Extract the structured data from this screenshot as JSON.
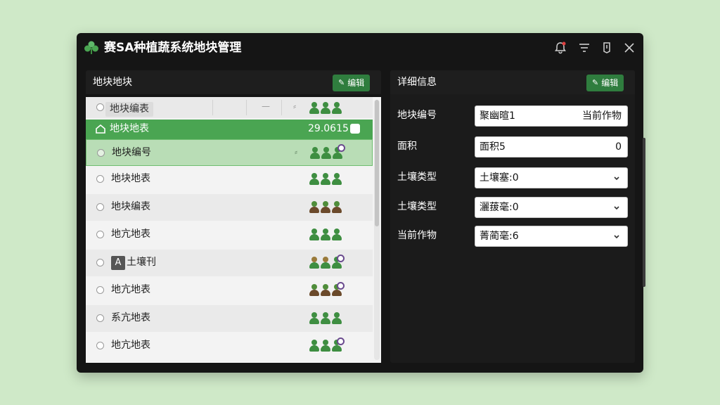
{
  "app": {
    "title": "赛SA种植蔬系统地块管理"
  },
  "left_panel": {
    "title": "地块地块",
    "edit_label": "编辑",
    "header_row": {
      "label": "地块编表",
      "dash": "—",
      "glyph": "⸗"
    },
    "selected_row": {
      "label": "地块地表",
      "date": "29.0615"
    },
    "rows": [
      {
        "label": "地块编号"
      },
      {
        "label": "地块地表"
      },
      {
        "label": "地块编表"
      },
      {
        "label": "地亢地表"
      },
      {
        "label": "土壤刊",
        "tag": "A"
      },
      {
        "label": "地亢地表"
      },
      {
        "label": "系亢地表"
      },
      {
        "label": "地亢地表"
      }
    ]
  },
  "right_panel": {
    "title": "详细信息",
    "edit_label": "编辑",
    "fields": [
      {
        "label": "地块编号",
        "value": "聚幽暄1",
        "right": "当前作物"
      },
      {
        "label": "面积",
        "value": "面积5",
        "right": "0"
      },
      {
        "label": "土壤类型",
        "value": "土壤塞:0",
        "dropdown": true
      },
      {
        "label": "土壤类型",
        "value": "灑菝毫:0",
        "dropdown": true
      },
      {
        "label": "当前作物",
        "value": "菁蔺毫:6",
        "dropdown": true
      }
    ]
  },
  "colors": {
    "accent": "#4aa552",
    "edit_button": "#2f7d3e",
    "window_bg": "#151515",
    "page_bg": "#cfe9c8"
  },
  "icons": [
    "clover-logo-icon",
    "bell-icon",
    "filter-icon",
    "pin-icon",
    "close-icon",
    "pencil-icon",
    "home-icon",
    "chevron-down-icon",
    "people-icon"
  ]
}
